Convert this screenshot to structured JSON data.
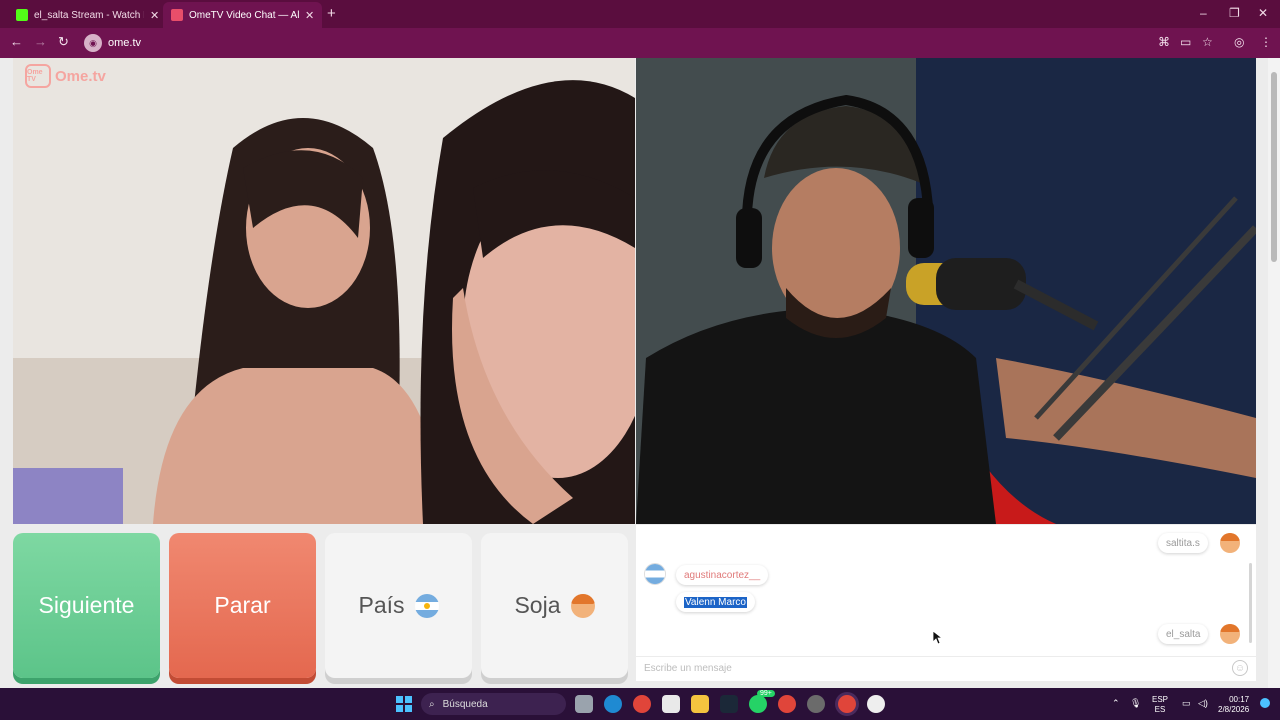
{
  "browser": {
    "tabs": [
      {
        "title": "el_salta Stream - Watch Live on",
        "active": false,
        "favicon_color": "#53fc18"
      },
      {
        "title": "OmeTV Video Chat — Alte",
        "active": true,
        "favicon_color": "#e84e6a"
      }
    ],
    "new_tab_label": "+",
    "url": "ome.tv",
    "window_controls": {
      "minimize": "–",
      "maximize": "❐",
      "close": "✕"
    }
  },
  "site": {
    "logo_mark": "Ome TV",
    "logo_text": "Ome.tv"
  },
  "controls": {
    "next_label": "Siguiente",
    "stop_label": "Parar",
    "country_label": "País",
    "gender_label": "Soja"
  },
  "chat": {
    "messages": [
      {
        "author": "saltita.s",
        "side": "right",
        "avatar": "face-emoji"
      },
      {
        "author": "agustinacortez__",
        "side": "left",
        "avatar": "argentina-flag",
        "text": "Valenn Marco"
      },
      {
        "author": "el_salta",
        "side": "right",
        "avatar": "face-emoji"
      }
    ],
    "input_placeholder": "Escribe un mensaje"
  },
  "taskbar": {
    "search_label": "Búsqueda",
    "badge": "99+",
    "language_line1": "ESP",
    "language_line2": "ES",
    "time": "00:17",
    "date": "2/8/2026"
  },
  "colors": {
    "tabbar": "#5a0d3e",
    "toolbar": "#6f1350",
    "next_button": "#6ccf96",
    "stop_button": "#ea7259",
    "selection": "#1c64c7"
  }
}
